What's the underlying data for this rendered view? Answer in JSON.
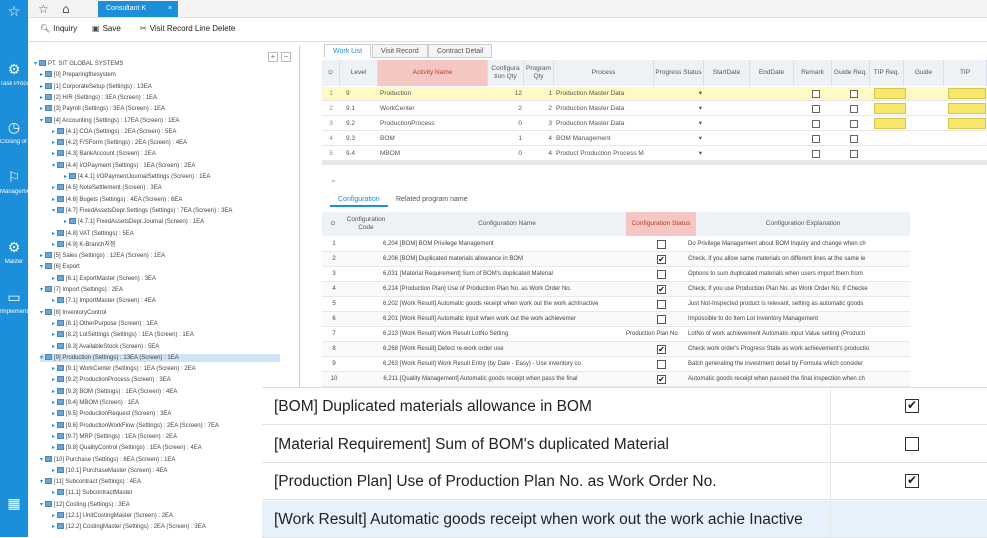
{
  "app": {
    "tab_label": "Consultant K",
    "close_glyph": "×"
  },
  "toolbar": {
    "inquiry": "Inquiry",
    "save": "Save",
    "visit_delete": "Visit Record Line Delete"
  },
  "leftnav": [
    {
      "icon": "☆",
      "label": ""
    },
    {
      "icon": "⚙",
      "label": "Task Processing"
    },
    {
      "icon": "◷",
      "label": "Closing of right time"
    },
    {
      "icon": "⚐",
      "label": "Management improvement"
    },
    {
      "icon": "⚙",
      "label": "Master"
    },
    {
      "icon": "▭",
      "label": "Implementation"
    },
    {
      "icon": "▦",
      "label": ""
    }
  ],
  "tree": [
    "PT. SIT GLOBAL SYSTEMS",
    "[0] Preparingthesystem",
    "[1] CorporateSetup (Settings) : 13EA",
    "[2] H/R (Settings) : 3EA (Screen) : 1EA",
    "[3] Payroll (Settings) : 3EA (Screen) : 1EA",
    "[4] Accounting (Settings) : 17EA (Screen) : 1EA",
    "[4.1] COA (Settings) : 2EA (Screen) : 5EA",
    "[4.2] F/SForm (Settings) : 2EA (Screen) : 4EA",
    "[4.3] BankAccount (Screen) : 2EA",
    "[4.4] I/OPayment (Settings) : 1EA (Screen) : 2EA",
    "[4.4.1] I/OPaymentJournalSettings (Screen) : 1EA",
    "[4.5] NoteSettlement (Screen) : 3EA",
    "[4.6] Bugets (Settings) : 4EA (Screen) : 6EA",
    "[4.7] FixedAssetsDepr.Settings (Settings) : 7EA (Screen) : 3EA",
    "[4.7.1] FixedAssetsDepr.Journal (Screen) : 1EA",
    "[4.8] VAT (Settings) : 5EA",
    "[4.9] K-Branch지점",
    "[5] Sales (Settings) : 12EA (Screen) : 1EA",
    "[6] Export",
    "[6.1] ExportMaster (Screen) : 3EA",
    "[7] Import (Settings) : 2EA",
    "[7.1] ImportMaster (Screen) : 4EA",
    "[8] InventoryControl",
    "[8.1] OtherPurpose (Screen) : 1EA",
    "[8.2] LotSettings (Settings) : 1EA (Screen) : 1EA",
    "[8.3] AvailableStock (Screen) : 5EA",
    "[9] Production (Settings) : 13EA (Screen) : 1EA",
    "[9.1] WorkCenter (Settings) : 1EA (Screen) : 2EA",
    "[9.2] ProductionProcess (Screen) : 3EA",
    "[9.3] BOM (Settings) : 1EA (Screen) : 4EA",
    "[9.4] MBOM (Screen) : 1EA",
    "[9.5] ProductionRequest (Screen) : 3EA",
    "[9.6] ProductionWorkFlow (Settings) : 2EA (Screen) : 7EA",
    "[9.7] MRP (Settings) : 1EA (Screen) : 2EA",
    "[9.8] QualityControl (Settings) : 1EA (Screen) : 4EA",
    "[10] Purchase (Settings) : 6EA (Screen) : 1EA",
    "[10.1] PurchaseMaster (Screen) : 4EA",
    "[11] Subcontract (Settings) : 4EA",
    "[11.1] SubcontractMaster",
    "[12] Costing (Settings) : 3EA",
    "[12.1] UnitCostingMaster (Screen) : 2EA",
    "[12.2] CostingMaster (Settings) : 2EA (Screen) : 3EA"
  ],
  "worktabs": [
    "Work List",
    "Visit Record",
    "Contract Detail"
  ],
  "grid_headers": [
    "Level",
    "Activity Name",
    "Configura tion Qty",
    "Program Qty",
    "Process",
    "Progress Status",
    "StartDate",
    "EndDate",
    "Remark",
    "Guide Req.",
    "TIP Req.",
    "Guide",
    "TIP"
  ],
  "grid_rows": [
    {
      "no": "1",
      "level": "9",
      "activity": "Production",
      "cqty": "12",
      "pqty": "1",
      "process": "Production Master Data"
    },
    {
      "no": "2",
      "level": "9.1",
      "activity": "WorkCenter",
      "cqty": "2",
      "pqty": "2",
      "process": "Production Master Data"
    },
    {
      "no": "3",
      "level": "9.2",
      "activity": "ProductionProcess",
      "cqty": "0",
      "pqty": "3",
      "process": "Production Master Data"
    },
    {
      "no": "4",
      "level": "9.3",
      "activity": "BOM",
      "cqty": "1",
      "pqty": "4",
      "process": "BOM Management"
    },
    {
      "no": "5",
      "level": "9.4",
      "activity": "MBOM",
      "cqty": "0",
      "pqty": "4",
      "process": "Product Production Process M"
    }
  ],
  "config_tabs": [
    "Configuration",
    "Related program name"
  ],
  "config_headers": [
    "Configuration Code",
    "Configuration Name",
    "Configuration Status",
    "Configuration Explanation"
  ],
  "config_rows": [
    {
      "no": "1",
      "code": "6,204",
      "name": "[BOM] BOM Privilege Management",
      "check": "",
      "expl": "Do Privilege Management about BOM Inquiry and change when ch"
    },
    {
      "no": "2",
      "code": "6,206",
      "name": "[BOM] Duplicated materials allowance in BOM",
      "check": "✔",
      "expl": "Check, if you allow same materials on different lines at the same le"
    },
    {
      "no": "3",
      "code": "6,031",
      "name": "[Material Requirement] Sum of BOM's duplicated Material",
      "check": "",
      "expl": "Options to sum duplicated materials when users import them from"
    },
    {
      "no": "4",
      "code": "6,214",
      "name": "[Production Plan] Use of Production Plan No. as Work Order No.",
      "check": "✔",
      "expl": "Check, if you use Production Plan No. as Work Order No. If Checke"
    },
    {
      "no": "5",
      "code": "6,202",
      "name": "[Work Result] Automatic goods receipt when work out the work achInactive",
      "check": "",
      "expl": "Just Not-Inspected product is relevant, setting as automatic goods"
    },
    {
      "no": "6",
      "code": "6,201",
      "name": "[Work Result] Automatic input when work out the work achievemer",
      "check": "",
      "expl": "Impossible to do Item Lot Inventory Management"
    },
    {
      "no": "7",
      "code": "6,213",
      "name": "[Work Result] Work Result LotNo Setting",
      "check": "Production Plan No",
      "expl": "LotNo of work achievement Automatic input Value setting (Producti"
    },
    {
      "no": "8",
      "code": "6,268",
      "name": "[Work Result] Defect re-work order use",
      "check": "✔",
      "expl": "Check work order's Progress State as work achievement's productio"
    },
    {
      "no": "9",
      "code": "6,263",
      "name": "[Work Result] Work Result Entry (by Date - Easy) - Use inventory co",
      "check": "",
      "expl": "Batch generating the investment detail by Formula which consider"
    },
    {
      "no": "10",
      "code": "6,211",
      "name": "[Quality Management] Automatic goods receipt when pass the final",
      "check": "✔",
      "expl": "Automatic goods receipt when passed the final inspection when ch"
    }
  ],
  "zoom_rows": [
    {
      "text": "[BOM] Duplicated materials allowance in BOM",
      "check": "✔"
    },
    {
      "text": "[Material Requirement] Sum of BOM's duplicated Material",
      "check": ""
    },
    {
      "text": "[Production Plan] Use of Production Plan No. as Work Order No.",
      "check": "✔"
    },
    {
      "text": "[Work Result] Automatic goods receipt when work out the work achie Inactive",
      "check": ""
    }
  ]
}
